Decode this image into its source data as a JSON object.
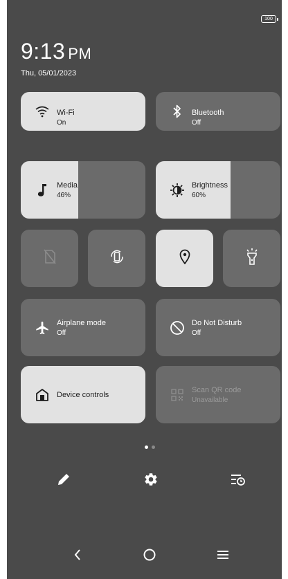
{
  "status_bar": {
    "battery": "100"
  },
  "clock": {
    "time": "9:13",
    "ampm": "PM",
    "date": "Thu, 05/01/2023"
  },
  "tiles": {
    "wifi": {
      "label": "Wi-Fi",
      "sub": "On"
    },
    "bluetooth": {
      "label": "Bluetooth",
      "sub": "Off"
    },
    "media": {
      "label": "Media",
      "sub": "46%",
      "level": 0.46
    },
    "brightness": {
      "label": "Brightness",
      "sub": "60%",
      "level": 0.6
    },
    "airplane": {
      "label": "Airplane mode",
      "sub": "Off"
    },
    "dnd": {
      "label": "Do Not Disturb",
      "sub": "Off"
    },
    "device_controls": {
      "label": "Device controls"
    },
    "scan_qr": {
      "label": "Scan QR code",
      "sub": "Unavailable"
    }
  },
  "quick_toggles": [
    "no-sim-icon",
    "auto-rotate-icon",
    "location-icon",
    "flashlight-icon"
  ],
  "pager": {
    "pages": 2,
    "current": 1
  },
  "bottom_actions": [
    "edit-icon",
    "settings-icon",
    "sort-icon"
  ],
  "nav": [
    "back-icon",
    "home-icon",
    "recents-icon"
  ],
  "colors": {
    "panel": "#4a4a4a",
    "tile_off": "#6b6b6b",
    "tile_on": "#e2e2e2"
  }
}
